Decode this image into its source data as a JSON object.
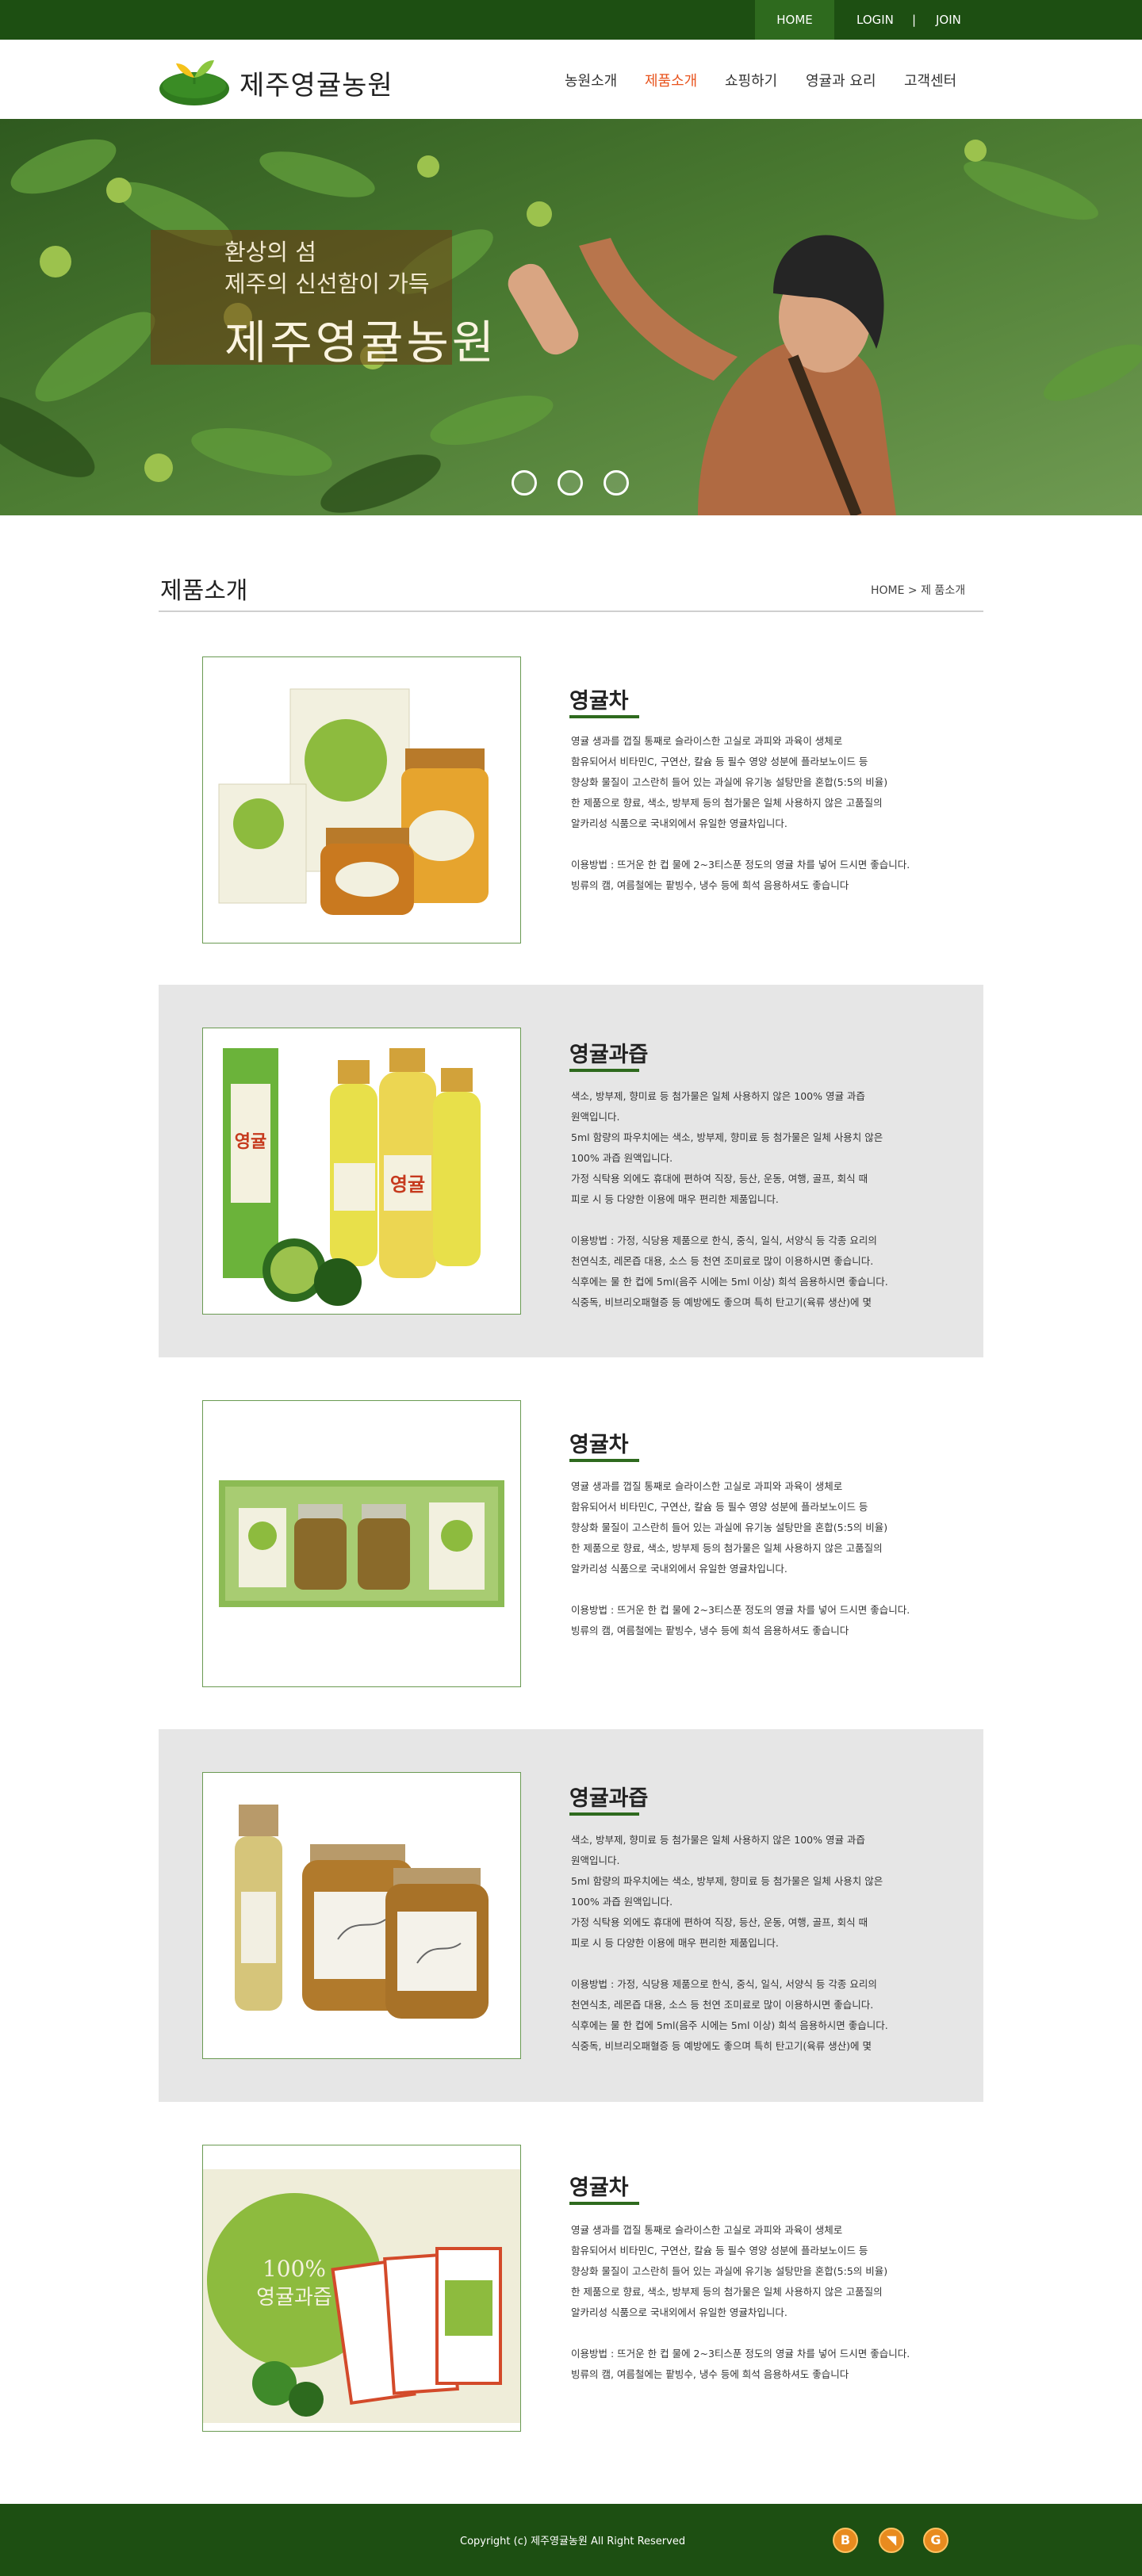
{
  "topbar": {
    "home": "HOME",
    "login": "LOGIN",
    "separator": "|",
    "join": "JOIN"
  },
  "header": {
    "logo_text": "제주영귤농원",
    "nav": [
      "농원소개",
      "제품소개",
      "쇼핑하기",
      "영귤과 요리",
      "고객센터"
    ],
    "active_nav": "제품소개"
  },
  "hero": {
    "line1": "환상의 섬",
    "line2": "제주의 신선함이 가득",
    "title": "제주영귤농원",
    "dots": 3
  },
  "section": {
    "title": "제품소개",
    "breadcrumb": "HOME > 제 품소개"
  },
  "products": [
    {
      "name": "영귤차",
      "desc": "영귤 생과를 껍질 통째로 슬라이스한 고실로 과피와 과육이 생체로\n함유되어서 비타민C, 구연산, 칼슘 등 필수 영양 성분에 플라보노이드 등\n향상화 물질이 고스란히 들어 있는 과실에 유기농 설탕만을 혼합(5:5의 비율)\n한 제품으로 향료, 색소, 방부제 등의 첨가물은 일체 사용하지 않은 고품질의\n알카리성 식품으로 국내외에서 유일한 영귤차입니다.\n\n이용방법 : 뜨거운 한 컵 물에 2~3티스푼 정도의 영귤 차를 넣어 드시면 좋습니다.\n빙류의 캠, 여름철에는 팥빙수, 냉수 등에 희석 음용하셔도 좋습니다"
    },
    {
      "name": "영귤과즙",
      "desc": "색소, 방부제, 향미료 등 첨가물은 일체 사용하지 않은 100% 영귤 과즙\n원액입니다.\n5ml 함량의 파우치에는 색소, 방부제, 향미료 등 첨가물은 일체 사용치 않은\n100% 과즙 원액입니다.\n가정 식탁용 외에도 휴대에 편하여 직장, 등산, 운동, 여행, 골프, 회식 때\n피로 시 등 다양한 이용에 매우 편리한 제품입니다.\n\n이용방법 : 가정, 식당용 제품으로 한식, 중식, 일식, 서양식 등 각종 요리의\n천연식초, 레몬즙 대용, 소스 등 천연 조미료로 많이 이용하시면 좋습니다.\n식후에는 물 한 컵에 5ml(음주 시에는 5ml 이상) 희석 음용하시면 좋습니다.\n식중독, 비브리오패혈증 등 예방에도 좋으며 특히 탄고기(육류 생산)에 몇"
    },
    {
      "name": "영귤차",
      "desc": "영귤 생과를 껍질 통째로 슬라이스한 고실로 과피와 과육이 생체로\n함유되어서 비타민C, 구연산, 칼슘 등 필수 영양 성분에 플라보노이드 등\n향상화 물질이 고스란히 들어 있는 과실에 유기농 설탕만을 혼합(5:5의 비율)\n한 제품으로 향료, 색소, 방부제 등의 첨가물은 일체 사용하지 않은 고품질의\n알카리성 식품으로 국내외에서 유일한 영귤차입니다.\n\n이용방법 : 뜨거운 한 컵 물에 2~3티스푼 정도의 영귤 차를 넣어 드시면 좋습니다.\n빙류의 캠, 여름철에는 팥빙수, 냉수 등에 희석 음용하셔도 좋습니다"
    },
    {
      "name": "영귤과즙",
      "desc": "색소, 방부제, 향미료 등 첨가물은 일체 사용하지 않은 100% 영귤 과즙\n원액입니다.\n5ml 함량의 파우치에는 색소, 방부제, 향미료 등 첨가물은 일체 사용치 않은\n100% 과즙 원액입니다.\n가정 식탁용 외에도 휴대에 편하여 직장, 등산, 운동, 여행, 골프, 회식 때\n피로 시 등 다양한 이용에 매우 편리한 제품입니다.\n\n이용방법 : 가정, 식당용 제품으로 한식, 중식, 일식, 서양식 등 각종 요리의\n천연식초, 레몬즙 대용, 소스 등 천연 조미료로 많이 이용하시면 좋습니다.\n식후에는 물 한 컵에 5ml(음주 시에는 5ml 이상) 희석 음용하시면 좋습니다.\n식중독, 비브리오패혈증 등 예방에도 좋으며 특히 탄고기(육류 생산)에 몇"
    },
    {
      "name": "영귤차",
      "desc": "영귤 생과를 껍질 통째로 슬라이스한 고실로 과피와 과육이 생체로\n함유되어서 비타민C, 구연산, 칼슘 등 필수 영양 성분에 플라보노이드 등\n향상화 물질이 고스란히 들어 있는 과실에 유기농 설탕만을 혼합(5:5의 비율)\n한 제품으로 향료, 색소, 방부제 등의 첨가물은 일체 사용하지 않은 고품질의\n알카리성 식품으로 국내외에서 유일한 영귤차입니다.\n\n이용방법 : 뜨거운 한 컵 물에 2~3티스푼 정도의 영귤 차를 넣어 드시면 좋습니다.\n빙류의 캠, 여름철에는 팥빙수, 냉수 등에 희석 음용하셔도 좋습니다"
    }
  ],
  "footer": {
    "copyright": "Copyright (c) 제주영귤농원 All Right Reserved",
    "icons": [
      "blogger-icon",
      "rss-icon",
      "google-icon"
    ],
    "icon_glyphs": [
      "B",
      "◥",
      "G"
    ]
  },
  "colors": {
    "dark_green": "#1d4f12",
    "accent_orange": "#e8541e",
    "row_gray": "#e6e6e6"
  }
}
